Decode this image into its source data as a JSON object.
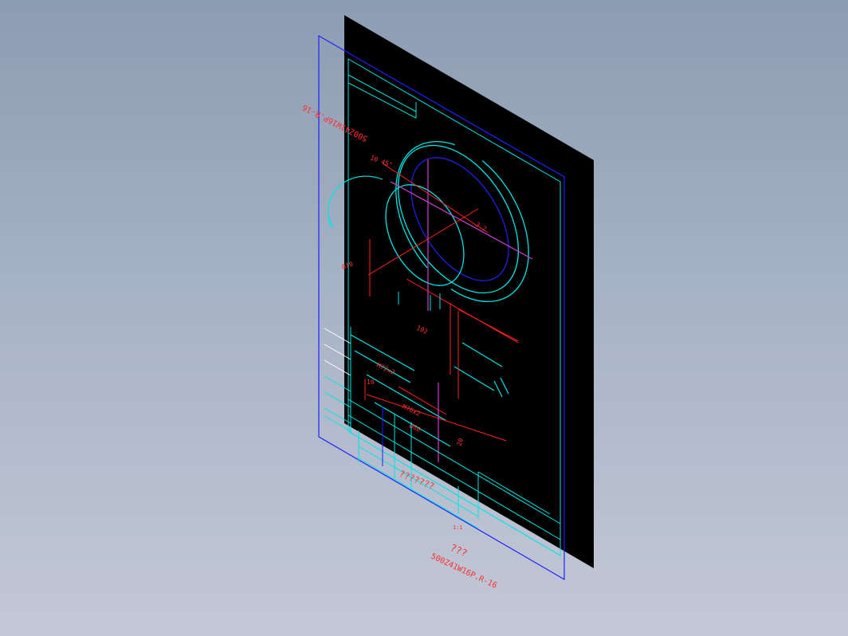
{
  "viewport": {
    "background_top": "#8c9cb2",
    "background_bottom": "#c3c8d6"
  },
  "colors": {
    "sheet": "#000000",
    "border": "#2020ff",
    "outline": "#00e5e5",
    "dimension": "#ff2020",
    "hole": "#2020e0",
    "axis": "#d040d0",
    "text": "#ff3030",
    "white": "#ffffff"
  },
  "drawing": {
    "part_code_top": "500Z41W16P.R-16",
    "part_code_bottom": "500Z41W16P.R-16",
    "title_placeholder": "???",
    "company_placeholder": "???????",
    "scale": "1:1",
    "dims": {
      "d_top": "10 45°",
      "d_angle": "30°",
      "d_diam_small": "Ø10",
      "d_width": "102",
      "d_thread_a": "M72x2",
      "d_thread_b": "M76x2",
      "d_diam_big": "Ø60",
      "d_height": "10",
      "d_rough": "3.2",
      "d_side": "20"
    }
  }
}
